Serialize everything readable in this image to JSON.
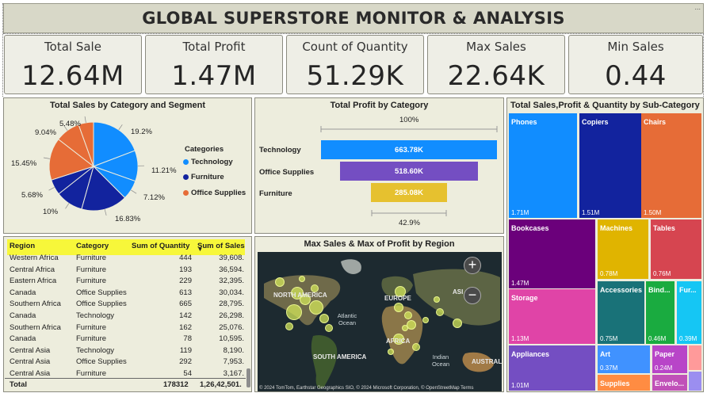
{
  "title": "GLOBAL SUPERSTORE MONITOR & ANALYSIS",
  "corner_menu": "...",
  "kpis": [
    {
      "label": "Total Sale",
      "value": "12.64M"
    },
    {
      "label": "Total Profit",
      "value": "1.47M"
    },
    {
      "label": "Count of Quantity",
      "value": "51.29K"
    },
    {
      "label": "Max Sales",
      "value": "22.64K"
    },
    {
      "label": "Min Sales",
      "value": "0.44"
    }
  ],
  "pie_panel": {
    "title": "Total Sales by Category and Segment",
    "legend_title": "Categories",
    "legend": [
      {
        "name": "Technology",
        "color": "#118dff"
      },
      {
        "name": "Furniture",
        "color": "#12239e"
      },
      {
        "name": "Office Supplies",
        "color": "#e66c37"
      }
    ]
  },
  "chart_data": [
    {
      "type": "pie",
      "title": "Total Sales by Category and Segment",
      "slices": [
        {
          "label": "19.2%",
          "value": 19.2,
          "category": "Technology",
          "color": "#118dff"
        },
        {
          "label": "11.21%",
          "value": 11.21,
          "category": "Technology",
          "color": "#118dff"
        },
        {
          "label": "7.12%",
          "value": 7.12,
          "category": "Technology",
          "color": "#118dff"
        },
        {
          "label": "16.83%",
          "value": 16.83,
          "category": "Furniture",
          "color": "#12239e"
        },
        {
          "label": "10%",
          "value": 10,
          "category": "Furniture",
          "color": "#12239e"
        },
        {
          "label": "5.68%",
          "value": 5.68,
          "category": "Furniture",
          "color": "#12239e"
        },
        {
          "label": "15.45%",
          "value": 15.45,
          "category": "Office Supplies",
          "color": "#e66c37"
        },
        {
          "label": "9.04%",
          "value": 9.04,
          "category": "Office Supplies",
          "color": "#e66c37"
        },
        {
          "label": "5.48%",
          "value": 5.48,
          "category": "Office Supplies",
          "color": "#e66c37"
        }
      ]
    },
    {
      "type": "bar",
      "subtype": "funnel",
      "title": "Total Profit by Category",
      "categories": [
        "Technology",
        "Office Supplies",
        "Furniture"
      ],
      "values": [
        663780,
        518600,
        285080
      ],
      "value_labels": [
        "663.78K",
        "518.60K",
        "285.08K"
      ],
      "colors": [
        "#118dff",
        "#744ec2",
        "#e6c12f"
      ],
      "top_pct": "100%",
      "bottom_pct": "42.9%"
    },
    {
      "type": "heatmap",
      "subtype": "treemap",
      "title": "Total Sales,Profit & Quantity by Sub-Category",
      "tiles": [
        {
          "name": "Phones",
          "value": "1.71M",
          "color": "#118dff"
        },
        {
          "name": "Copiers",
          "value": "1.51M",
          "color": "#12239e"
        },
        {
          "name": "Chairs",
          "value": "1.50M",
          "color": "#e66c37"
        },
        {
          "name": "Bookcases",
          "value": "1.47M",
          "color": "#6b007b"
        },
        {
          "name": "Machines",
          "value": "0.78M",
          "color": "#e0b400"
        },
        {
          "name": "Tables",
          "value": "0.76M",
          "color": "#d64550"
        },
        {
          "name": "Storage",
          "value": "1.13M",
          "color": "#e044a7"
        },
        {
          "name": "Accessories",
          "value": "0.75M",
          "color": "#197278"
        },
        {
          "name": "Bind...",
          "value": "0.46M",
          "color": "#1aab40"
        },
        {
          "name": "Fur...",
          "value": "0.39M",
          "color": "#15c6f4"
        },
        {
          "name": "Appliances",
          "value": "1.01M",
          "color": "#744ec2"
        },
        {
          "name": "Art",
          "value": "0.37M",
          "color": "#4092ff"
        },
        {
          "name": "Paper",
          "value": "0.24M",
          "color": "#b845c8"
        },
        {
          "name": "",
          "value": "",
          "color": "#ff9a9a"
        },
        {
          "name": "",
          "value": "",
          "color": "#9b8ef0"
        },
        {
          "name": "Supplies",
          "value": "",
          "color": "#ff8c42"
        },
        {
          "name": "Envelo...",
          "value": "",
          "color": "#c050b8"
        }
      ]
    },
    {
      "type": "scatter",
      "subtype": "bubble-map",
      "title": "Max Sales & Max of Profit by Region"
    }
  ],
  "table": {
    "headers": [
      "Region",
      "Category",
      "Sum of Quantity",
      "Sum of Sales"
    ],
    "sort_indicator": "▼",
    "rows": [
      [
        "Western Africa",
        "Furniture",
        "444",
        "39,608."
      ],
      [
        "Central Africa",
        "Furniture",
        "193",
        "36,594."
      ],
      [
        "Eastern Africa",
        "Furniture",
        "229",
        "32,395."
      ],
      [
        "Canada",
        "Office Supplies",
        "613",
        "30,034."
      ],
      [
        "Southern Africa",
        "Office Supplies",
        "665",
        "28,795."
      ],
      [
        "Canada",
        "Technology",
        "142",
        "26,298."
      ],
      [
        "Southern Africa",
        "Furniture",
        "162",
        "25,076."
      ],
      [
        "Canada",
        "Furniture",
        "78",
        "10,595."
      ],
      [
        "Central Asia",
        "Technology",
        "119",
        "8,190."
      ],
      [
        "Central Asia",
        "Office Supplies",
        "292",
        "7,953."
      ],
      [
        "Central Asia",
        "Furniture",
        "54",
        "3,167."
      ]
    ],
    "total": [
      "Total",
      "178312",
      "1,26,42,501."
    ]
  },
  "map": {
    "title": "Max Sales & Max of Profit by Region",
    "labels": [
      "NORTH AMERICA",
      "EUROPE",
      "ASI",
      "AFRICA",
      "SOUTH AMERICA",
      "AUSTRAL"
    ],
    "oceans": [
      "Atlantic Ocean",
      "Indian Ocean"
    ],
    "zoom_in": "+",
    "zoom_out": "−",
    "credit": "© 2024 TomTom, Earthstar Geographics SIO, © 2024 Microsoft Corporation, © OpenStreetMap  Terms"
  }
}
